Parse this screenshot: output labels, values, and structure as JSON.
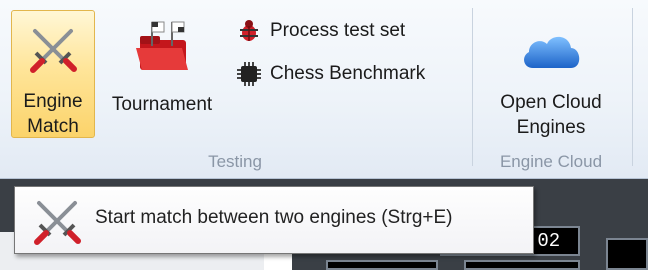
{
  "ribbon": {
    "testing_group": {
      "label": "Testing",
      "engine_match": {
        "line1": "Engine",
        "line2": "Match",
        "icon": "crossed-swords-icon"
      },
      "tournament": {
        "label": "Tournament",
        "icon": "red-folder-flags-icon"
      },
      "process_test_set": {
        "label": "Process test set",
        "icon": "bug-icon"
      },
      "chess_benchmark": {
        "label": "Chess Benchmark",
        "icon": "chip-icon"
      }
    },
    "engine_cloud_group": {
      "label": "Engine Cloud",
      "open_cloud": {
        "line1": "Open Cloud",
        "line2": "Engines",
        "icon": "cloud-icon"
      }
    }
  },
  "tooltip": {
    "text": "Start match between two engines (Strg+E)",
    "icon": "crossed-swords-icon"
  },
  "clock": {
    "value": ":02"
  },
  "colors": {
    "active_button": "#fbd36a",
    "group_label": "#8a96a6",
    "cloud_blue": "#2f7fd8"
  }
}
